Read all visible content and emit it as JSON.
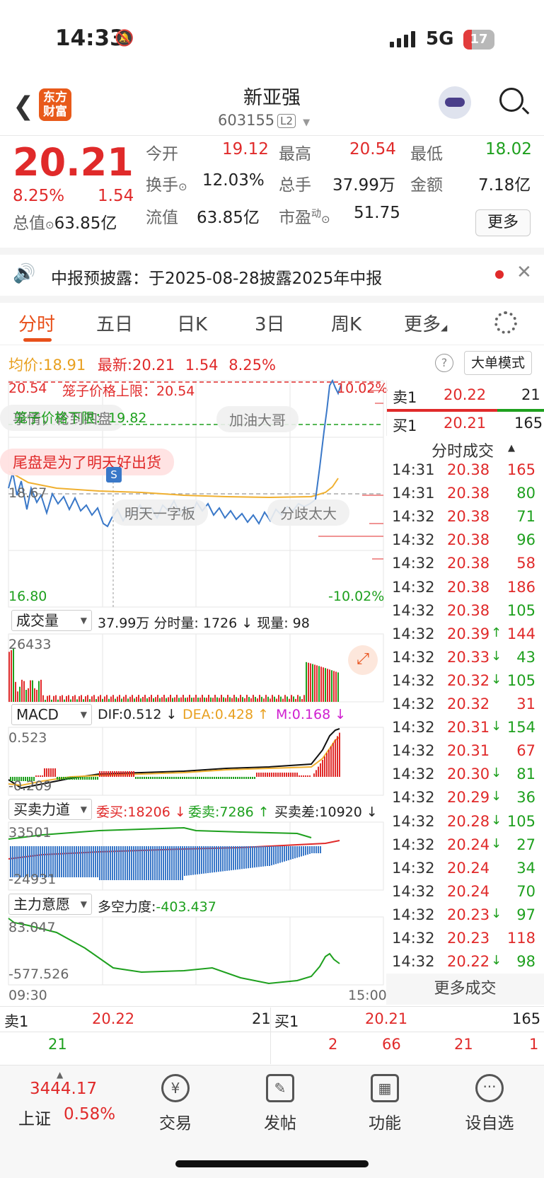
{
  "status_bar": {
    "time": "14:33",
    "network": "5G",
    "battery": "17"
  },
  "header": {
    "stock_name": "新亚强",
    "stock_code": "603155",
    "level_badge": "L2",
    "logo_text": "东方\n财富"
  },
  "quote": {
    "price": "20.21",
    "change_pct": "8.25%",
    "change_amt": "1.54",
    "open_label": "今开",
    "open": "19.12",
    "high_label": "最高",
    "high": "20.54",
    "low_label": "最低",
    "low": "18.02",
    "turnover_label": "换手",
    "turnover": "12.03%",
    "volume_label": "总手",
    "volume": "37.99万",
    "amount_label": "金额",
    "amount": "7.18亿",
    "mktcap_label": "总值",
    "mktcap": "63.85亿",
    "float_label": "流值",
    "float_cap": "63.85亿",
    "pe_label": "市盈",
    "pe_sup": "动",
    "pe": "51.75",
    "more_btn": "更多"
  },
  "notice": {
    "text": "中报预披露：于2025-08-28披露2025年中报"
  },
  "tabs": [
    "分时",
    "五日",
    "日K",
    "3日",
    "周K",
    "更多"
  ],
  "info_bar": {
    "avg_label": "均价:",
    "avg": "18.91",
    "latest_label": "最新:",
    "latest": "20.21",
    "chg": "1.54",
    "pct": "8.25%",
    "big_order_btn": "大单模式"
  },
  "intraday": {
    "top_price": "20.54",
    "top_pct": "10.02%",
    "bottom_price": "16.80",
    "bottom_pct": "-10.02%",
    "mid_price": "18.67",
    "upper_limit_label": "笼子价格上限：20.54",
    "lower_limit_label": "笼子价格下限：19.82",
    "comment1": "事情，轮到四盘",
    "comment2": "加油大哥",
    "comment3": "尾盘是为了明天好出货",
    "comment4": "明天一字板",
    "comment5": "分歧太大",
    "start_time": "09:30",
    "end_time": "15:00",
    "marker": "S"
  },
  "volume": {
    "dropdown": "成交量",
    "summary": "37.99万 分时量: 1726 ↓ 现量: 98",
    "max": "26433"
  },
  "macd": {
    "dropdown": "MACD",
    "dif": "DIF:0.512 ↓",
    "dea": "DEA:0.428 ↑",
    "m": "M:0.168 ↓",
    "top": "0.523",
    "bottom": "-0.209"
  },
  "force": {
    "dropdown": "买卖力道",
    "buy": "委买:18206 ↓",
    "sell": "委卖:7286 ↑",
    "diff": "买卖差:10920 ↓",
    "top": "33501",
    "bottom": "-24931"
  },
  "intent": {
    "dropdown": "主力意愿",
    "label": "多空力度:",
    "value": "-403.437",
    "top": "83.047",
    "bottom": "-577.526"
  },
  "orderbook_side": {
    "sell_label": "卖1",
    "sell_price": "20.22",
    "sell_qty": "21",
    "buy_label": "买1",
    "buy_price": "20.21",
    "buy_qty": "165"
  },
  "ticks_title": "分时成交",
  "ticks_more": "更多成交",
  "ticks": [
    {
      "t": "14:31",
      "p": "20.38",
      "a": "",
      "v": "165",
      "c": "r"
    },
    {
      "t": "14:31",
      "p": "20.38",
      "a": "",
      "v": "80",
      "c": "g"
    },
    {
      "t": "14:32",
      "p": "20.38",
      "a": "",
      "v": "71",
      "c": "g"
    },
    {
      "t": "14:32",
      "p": "20.38",
      "a": "",
      "v": "96",
      "c": "g"
    },
    {
      "t": "14:32",
      "p": "20.38",
      "a": "",
      "v": "58",
      "c": "r"
    },
    {
      "t": "14:32",
      "p": "20.38",
      "a": "",
      "v": "186",
      "c": "r"
    },
    {
      "t": "14:32",
      "p": "20.38",
      "a": "",
      "v": "105",
      "c": "g"
    },
    {
      "t": "14:32",
      "p": "20.39",
      "a": "↑",
      "v": "144",
      "c": "r"
    },
    {
      "t": "14:32",
      "p": "20.33",
      "a": "↓",
      "v": "43",
      "c": "g"
    },
    {
      "t": "14:32",
      "p": "20.32",
      "a": "↓",
      "v": "105",
      "c": "g"
    },
    {
      "t": "14:32",
      "p": "20.32",
      "a": "",
      "v": "31",
      "c": "r"
    },
    {
      "t": "14:32",
      "p": "20.31",
      "a": "↓",
      "v": "154",
      "c": "g"
    },
    {
      "t": "14:32",
      "p": "20.31",
      "a": "",
      "v": "67",
      "c": "r"
    },
    {
      "t": "14:32",
      "p": "20.30",
      "a": "↓",
      "v": "81",
      "c": "g"
    },
    {
      "t": "14:32",
      "p": "20.29",
      "a": "↓",
      "v": "36",
      "c": "g"
    },
    {
      "t": "14:32",
      "p": "20.28",
      "a": "↓",
      "v": "105",
      "c": "g"
    },
    {
      "t": "14:32",
      "p": "20.24",
      "a": "↓",
      "v": "27",
      "c": "g"
    },
    {
      "t": "14:32",
      "p": "20.24",
      "a": "",
      "v": "34",
      "c": "g"
    },
    {
      "t": "14:32",
      "p": "20.24",
      "a": "",
      "v": "70",
      "c": "g"
    },
    {
      "t": "14:32",
      "p": "20.23",
      "a": "↓",
      "v": "97",
      "c": "g"
    },
    {
      "t": "14:32",
      "p": "20.23",
      "a": "",
      "v": "118",
      "c": "r"
    },
    {
      "t": "14:32",
      "p": "20.22",
      "a": "↓",
      "v": "98",
      "c": "g"
    }
  ],
  "bottom_book": {
    "sell_label": "卖1",
    "sell_price": "20.22",
    "sell_qty": "21",
    "buy_label": "买1",
    "buy_price": "20.21",
    "buy_qty": "165",
    "sell_row2": "21",
    "buy_row2": [
      "2",
      "66",
      "21",
      "1"
    ]
  },
  "bottom_nav": {
    "index_value": "3444.17",
    "index_name": "上证",
    "index_pct": "0.58%",
    "items": [
      "交易",
      "发帖",
      "功能",
      "设自选"
    ]
  },
  "colors": {
    "up": "#e02a2a",
    "down": "#1ea01e",
    "accent": "#e8501a",
    "avg_line": "#f0b030",
    "price_line": "#3a78c8"
  }
}
